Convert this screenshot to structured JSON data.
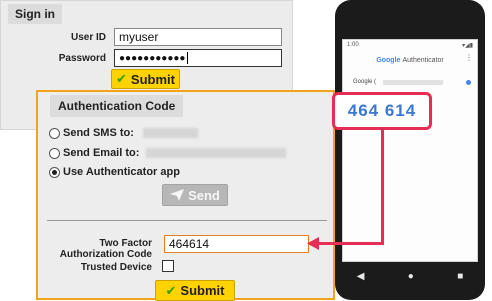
{
  "signin": {
    "title": "Sign in",
    "user_id_label": "User ID",
    "user_id_value": "myuser",
    "password_label": "Password",
    "password_mask": "●●●●●●●●●●●",
    "submit_label": "Submit"
  },
  "auth": {
    "title": "Authentication Code",
    "options": [
      {
        "label": "Send SMS to:",
        "selected": false
      },
      {
        "label": "Send Email to:",
        "selected": false
      },
      {
        "label": "Use Authenticator app",
        "selected": true
      }
    ],
    "send_label": "Send",
    "two_factor_label_1": "Two Factor",
    "two_factor_label_2": "Authorization Code",
    "code_value": "464614",
    "trusted_label": "Trusted Device",
    "submit_label": "Submit"
  },
  "phone": {
    "time": "1:00",
    "app_title": "Authenticator",
    "brand": "Google",
    "account_prefix": "Google (",
    "code_display": "464 614"
  },
  "colors": {
    "accent_orange": "#f2a31a",
    "submit_yellow": "#ffd200",
    "highlight_red": "#e62d55",
    "code_blue": "#3b78cf"
  }
}
